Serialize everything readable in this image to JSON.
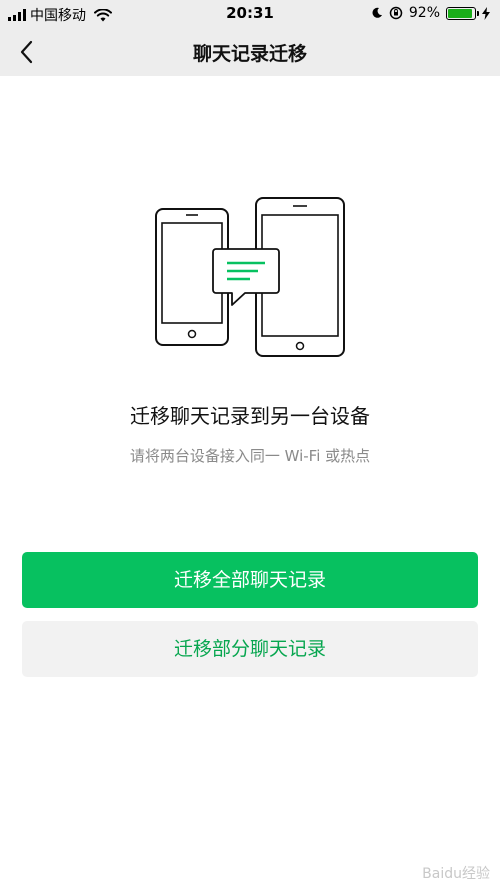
{
  "status_bar": {
    "carrier": "中国移动",
    "time": "20:31",
    "battery_percent": "92%",
    "battery_level": 0.92,
    "icons": [
      "signal-icon",
      "wifi-icon",
      "moon-icon",
      "orientation-lock-icon",
      "battery-icon",
      "charging-icon"
    ]
  },
  "nav": {
    "title": "聊天记录迁移",
    "back_icon": "chevron-left-icon"
  },
  "content": {
    "title": "迁移聊天记录到另一台设备",
    "subtitle": "请将两台设备接入同一 Wi-Fi 或热点"
  },
  "actions": {
    "migrate_all": "迁移全部聊天记录",
    "migrate_partial": "迁移部分聊天记录"
  },
  "watermark": "Baidu经验",
  "colors": {
    "accent": "#07c160",
    "secondary_text": "#07a64f",
    "bar_background": "#ededed"
  }
}
